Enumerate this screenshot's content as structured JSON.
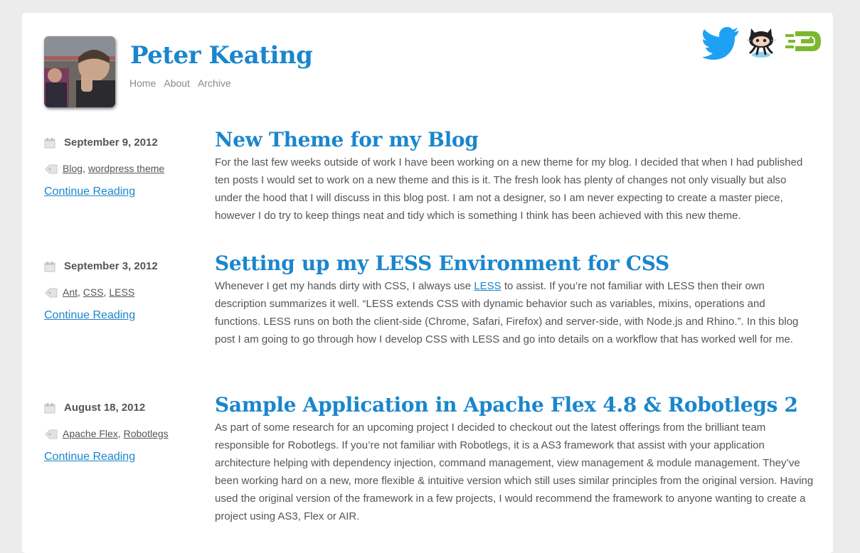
{
  "site": {
    "title": "Peter Keating",
    "nav": [
      "Home",
      "About",
      "Archive"
    ]
  },
  "social": [
    {
      "name": "twitter-icon",
      "color": "#1ea1f2"
    },
    {
      "name": "github-octocat-icon",
      "color": "#222222"
    },
    {
      "name": "ebay-icon",
      "color": "#7cb82f"
    }
  ],
  "colors": {
    "accent": "#1a86cc",
    "text": "#555555",
    "background": "#ececec"
  },
  "posts": [
    {
      "date": "September 9, 2012",
      "tags": [
        "Blog",
        "wordpress theme"
      ],
      "continue_label": "Continue Reading",
      "title": "New Theme for my Blog",
      "body": "For the last few weeks outside of work I have been working on a new theme for my blog. I decided that when I had published ten posts I would set to work on a new theme and this is it. The fresh look has plenty of changes not only visually but also under the hood that I will discuss in this blog post. I am not a designer, so I am never expecting to create a master piece, however I do try to keep things neat and tidy which is something I think has been achieved with this new theme."
    },
    {
      "date": "September 3, 2012",
      "tags": [
        "Ant",
        "CSS",
        "LESS"
      ],
      "continue_label": "Continue Reading",
      "title": "Setting up my LESS Environment for CSS",
      "body_before_link": "Whenever I get my hands dirty with CSS, I always use ",
      "body_link": "LESS",
      "body_after_link": " to assist. If you’re not familiar with LESS then their own description summarizes it well. “LESS extends CSS with dynamic behavior such as variables, mixins, operations and functions. LESS runs on both the client-side (Chrome, Safari, Firefox) and server-side, with Node.js and Rhino.”. In this blog post I am going to go through how I develop CSS with LESS and go into details on a workflow that has worked well for me."
    },
    {
      "date": "August 18, 2012",
      "tags": [
        "Apache Flex",
        "Robotlegs"
      ],
      "continue_label": "Continue Reading",
      "title": "Sample Application in Apache Flex 4.8 & Robotlegs 2",
      "body": "As part of some research for an upcoming project I decided to checkout out the latest offerings from the brilliant team responsible for Robotlegs. If you’re not familiar with Robotlegs, it is a AS3 framework that assist with your application architecture helping with dependency injection, command management, view management & module management. They’ve been working hard on a new, more flexible & intuitive version which still uses similar principles from the original version. Having used the original version of the framework in a few projects, I would recommend the framework to anyone wanting to create a project using AS3, Flex or AIR."
    }
  ]
}
